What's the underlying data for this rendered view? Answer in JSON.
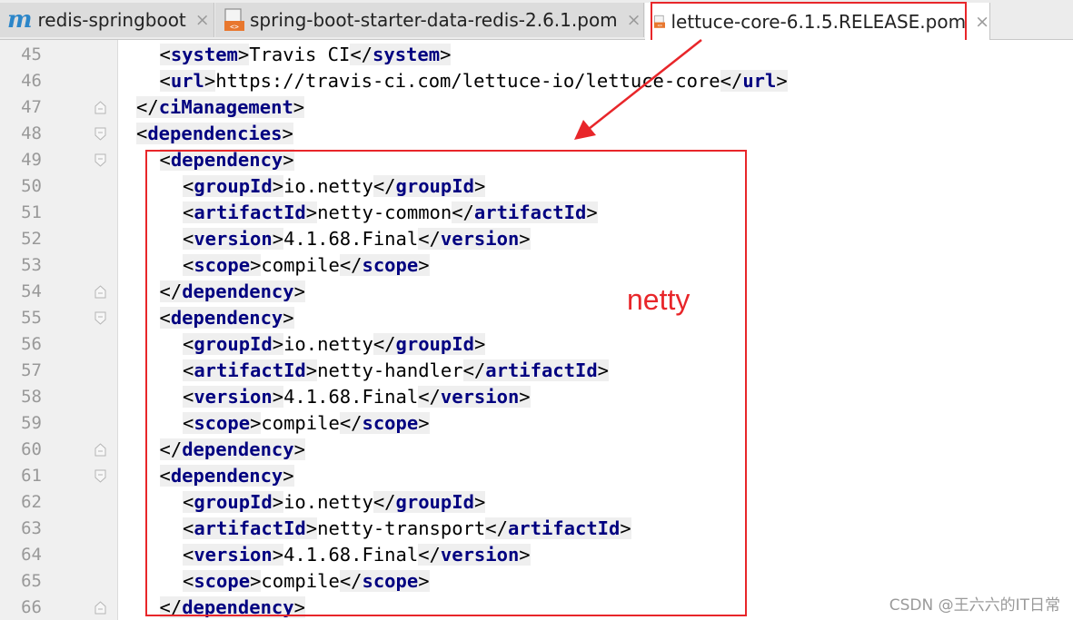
{
  "tabs": [
    {
      "label": "redis-springboot",
      "icon": "m-letter-icon",
      "active": false
    },
    {
      "label": "spring-boot-starter-data-redis-2.6.1.pom",
      "icon": "pom-file-icon",
      "active": false
    },
    {
      "label": "lettuce-core-6.1.5.RELEASE.pom",
      "icon": "pom-file-icon",
      "active": true
    }
  ],
  "tab_close_glyph": "×",
  "editor": {
    "lines": [
      {
        "n": "45",
        "indent": 1,
        "open": "system",
        "text": "Travis CI",
        "close": "system"
      },
      {
        "n": "46",
        "indent": 1,
        "open": "url",
        "text": "https://travis-ci.com/lettuce-io/lettuce-core",
        "close": "url"
      },
      {
        "n": "47",
        "indent": 0,
        "close": "ciManagement",
        "fold": "end"
      },
      {
        "n": "48",
        "indent": 0,
        "open": "dependencies",
        "fold": "start"
      },
      {
        "n": "49",
        "indent": 1,
        "open": "dependency",
        "fold": "start"
      },
      {
        "n": "50",
        "indent": 2,
        "open": "groupId",
        "text": "io.netty",
        "close": "groupId"
      },
      {
        "n": "51",
        "indent": 2,
        "open": "artifactId",
        "text": "netty-common",
        "close": "artifactId"
      },
      {
        "n": "52",
        "indent": 2,
        "open": "version",
        "text": "4.1.68.Final",
        "close": "version"
      },
      {
        "n": "53",
        "indent": 2,
        "open": "scope",
        "text": "compile",
        "close": "scope"
      },
      {
        "n": "54",
        "indent": 1,
        "close": "dependency",
        "fold": "end"
      },
      {
        "n": "55",
        "indent": 1,
        "open": "dependency",
        "fold": "start"
      },
      {
        "n": "56",
        "indent": 2,
        "open": "groupId",
        "text": "io.netty",
        "close": "groupId"
      },
      {
        "n": "57",
        "indent": 2,
        "open": "artifactId",
        "text": "netty-handler",
        "close": "artifactId"
      },
      {
        "n": "58",
        "indent": 2,
        "open": "version",
        "text": "4.1.68.Final",
        "close": "version"
      },
      {
        "n": "59",
        "indent": 2,
        "open": "scope",
        "text": "compile",
        "close": "scope"
      },
      {
        "n": "60",
        "indent": 1,
        "close": "dependency",
        "fold": "end"
      },
      {
        "n": "61",
        "indent": 1,
        "open": "dependency",
        "fold": "start"
      },
      {
        "n": "62",
        "indent": 2,
        "open": "groupId",
        "text": "io.netty",
        "close": "groupId"
      },
      {
        "n": "63",
        "indent": 2,
        "open": "artifactId",
        "text": "netty-transport",
        "close": "artifactId"
      },
      {
        "n": "64",
        "indent": 2,
        "open": "version",
        "text": "4.1.68.Final",
        "close": "version"
      },
      {
        "n": "65",
        "indent": 2,
        "open": "scope",
        "text": "compile",
        "close": "scope"
      },
      {
        "n": "66",
        "indent": 1,
        "close": "dependency",
        "fold": "end"
      }
    ]
  },
  "annotation": {
    "label": "netty",
    "color": "#e8262a"
  },
  "watermark": "CSDN @王六六的IT日常",
  "colors": {
    "tag": "#000080",
    "line_number": "#999999",
    "annotation": "#e8262a",
    "m_icon": "#2c86c9"
  }
}
